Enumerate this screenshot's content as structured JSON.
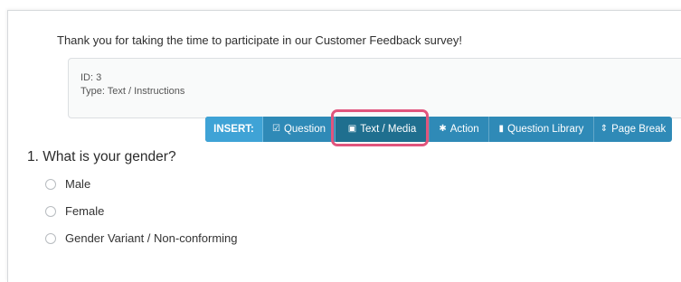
{
  "intro": {
    "text": "Thank you for taking the time to participate in our Customer Feedback survey!"
  },
  "meta": {
    "id": "ID: 3",
    "type": "Type: Text / Instructions"
  },
  "insert_bar": {
    "label": "INSERT:",
    "items": [
      {
        "icon": "checkbox-icon",
        "glyph": "☑",
        "label": "Question"
      },
      {
        "icon": "image-icon",
        "glyph": "▣",
        "label": "Text / Media"
      },
      {
        "icon": "gear-icon",
        "glyph": "✱",
        "label": "Action"
      },
      {
        "icon": "bookmark-icon",
        "glyph": "▮",
        "label": "Question Library"
      },
      {
        "icon": "sort-icon",
        "glyph": "⇕",
        "label": "Page Break"
      }
    ]
  },
  "question": {
    "title": "1. What is your gender?",
    "options": [
      "Male",
      "Female",
      "Gender Variant / Non-conforming"
    ]
  },
  "colors": {
    "insert_bar": "#2f8ab7",
    "insert_label": "#3fa3d6",
    "highlight": "#e1557d"
  }
}
